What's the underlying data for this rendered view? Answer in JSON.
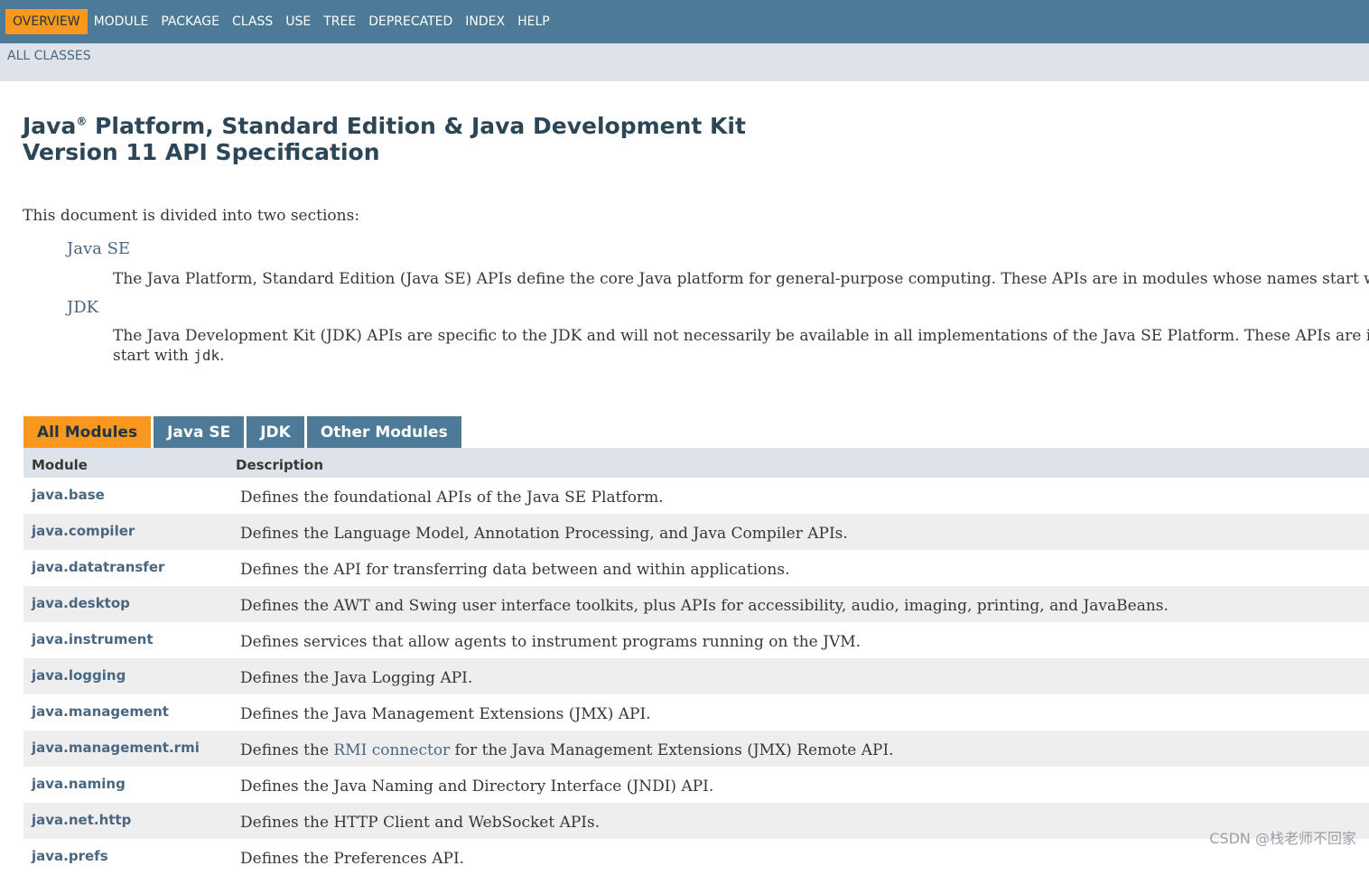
{
  "nav": {
    "items": [
      "OVERVIEW",
      "MODULE",
      "PACKAGE",
      "CLASS",
      "USE",
      "TREE",
      "DEPRECATED",
      "INDEX",
      "HELP"
    ],
    "active": "OVERVIEW"
  },
  "subnav": {
    "all_classes": "ALL CLASSES"
  },
  "header": {
    "title_part1": "Java",
    "title_reg": "®",
    "title_part2": " Platform, Standard Edition & Java Development Kit",
    "title_line2": "Version 11 API Specification"
  },
  "intro": "This document is divided into two sections:",
  "sections": [
    {
      "term": "Java SE",
      "desc": "The Java Platform, Standard Edition (Java SE) APIs define the core Java platform for general-purpose computing. These APIs are in modules whose names start with java."
    },
    {
      "term": "JDK",
      "desc_line1": "The Java Development Kit (JDK) APIs are specific to the JDK and will not necessarily be available in all implementations of the Java SE Platform. These APIs are in modules whose names",
      "desc_line2_prefix": "start with ",
      "desc_line2_code": "jdk",
      "desc_line2_suffix": "."
    }
  ],
  "tabs": [
    "All Modules",
    "Java SE",
    "JDK",
    "Other Modules"
  ],
  "table": {
    "headers": [
      "Module",
      "Description"
    ],
    "rows": [
      {
        "module": "java.base",
        "desc": "Defines the foundational APIs of the Java SE Platform."
      },
      {
        "module": "java.compiler",
        "desc": "Defines the Language Model, Annotation Processing, and Java Compiler APIs."
      },
      {
        "module": "java.datatransfer",
        "desc": "Defines the API for transferring data between and within applications."
      },
      {
        "module": "java.desktop",
        "desc": "Defines the AWT and Swing user interface toolkits, plus APIs for accessibility, audio, imaging, printing, and JavaBeans."
      },
      {
        "module": "java.instrument",
        "desc": "Defines services that allow agents to instrument programs running on the JVM."
      },
      {
        "module": "java.logging",
        "desc": "Defines the Java Logging API."
      },
      {
        "module": "java.management",
        "desc": "Defines the Java Management Extensions (JMX) API."
      },
      {
        "module": "java.management.rmi",
        "desc_prefix": "Defines the ",
        "desc_link": "RMI connector",
        "desc_suffix": " for the Java Management Extensions (JMX) Remote API."
      },
      {
        "module": "java.naming",
        "desc": "Defines the Java Naming and Directory Interface (JNDI) API."
      },
      {
        "module": "java.net.http",
        "desc": "Defines the HTTP Client and WebSocket APIs."
      },
      {
        "module": "java.prefs",
        "desc": "Defines the Preferences API."
      }
    ]
  },
  "watermark": "CSDN @栈老师不回家",
  "colors": {
    "nav_bg": "#4d7a97",
    "accent": "#f8981d",
    "subnav_bg": "#dee3e9",
    "link": "#4a6782"
  }
}
